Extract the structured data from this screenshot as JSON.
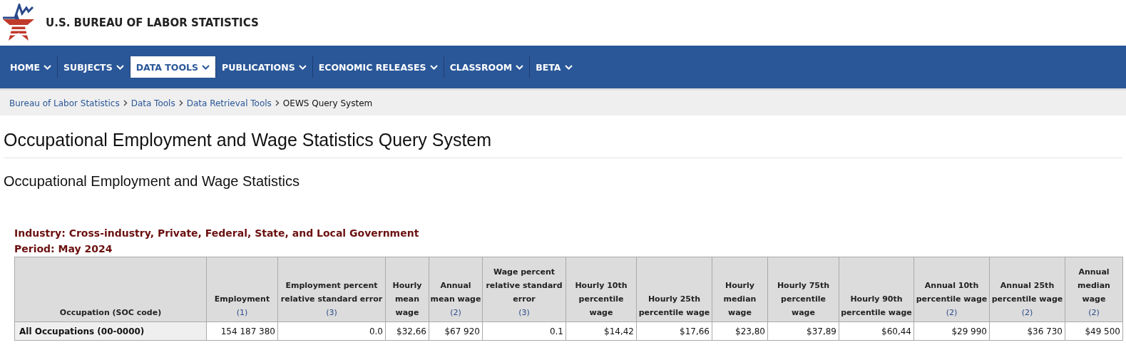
{
  "site": {
    "title": "U.S. BUREAU OF LABOR STATISTICS"
  },
  "nav": [
    {
      "label": "HOME",
      "selected": false
    },
    {
      "label": "SUBJECTS",
      "selected": false
    },
    {
      "label": "DATA TOOLS",
      "selected": true
    },
    {
      "label": "PUBLICATIONS",
      "selected": false
    },
    {
      "label": "ECONOMIC RELEASES",
      "selected": false
    },
    {
      "label": "CLASSROOM",
      "selected": false
    },
    {
      "label": "BETA",
      "selected": false
    }
  ],
  "breadcrumb": [
    {
      "label": "Bureau of Labor Statistics",
      "kind": "link"
    },
    {
      "label": "Data Tools",
      "kind": "link"
    },
    {
      "label": "Data Retrieval Tools",
      "kind": "link"
    },
    {
      "label": "OEWS Query System",
      "kind": "current"
    }
  ],
  "page_title": "Occupational Employment and Wage Statistics Query System",
  "subtitle": "Occupational Employment and Wage Statistics",
  "table": {
    "captions": [
      "Industry: Cross-industry, Private, Federal, State, and Local Government",
      "Period: May 2024"
    ],
    "columns": [
      {
        "label": "Occupation (SOC code)"
      },
      {
        "label": "Employment",
        "note": "(1)"
      },
      {
        "label": "Employment percent relative standard error",
        "note": "(3)"
      },
      {
        "label": "Hourly mean wage"
      },
      {
        "label": "Annual mean wage",
        "note": "(2)"
      },
      {
        "label": "Wage percent relative standard error",
        "note": "(3)"
      },
      {
        "label": "Hourly 10th percentile wage"
      },
      {
        "label": "Hourly 25th percentile wage"
      },
      {
        "label": "Hourly median wage"
      },
      {
        "label": "Hourly 75th percentile wage"
      },
      {
        "label": "Hourly 90th percentile wage"
      },
      {
        "label": "Annual 10th percentile wage",
        "note": "(2)"
      },
      {
        "label": "Annual 25th percentile wage",
        "note": "(2)"
      },
      {
        "label": "Annual median wage",
        "note": "(2)"
      }
    ],
    "rows": [
      {
        "cells": [
          "All Occupations (00-0000)",
          "154 187 380",
          "0.0",
          "$32,66",
          "$67 920",
          "0.1",
          "$14,42",
          "$17,66",
          "$23,80",
          "$37,89",
          "$60,44",
          "$29 990",
          "$36 730",
          "$49 500"
        ]
      }
    ]
  }
}
